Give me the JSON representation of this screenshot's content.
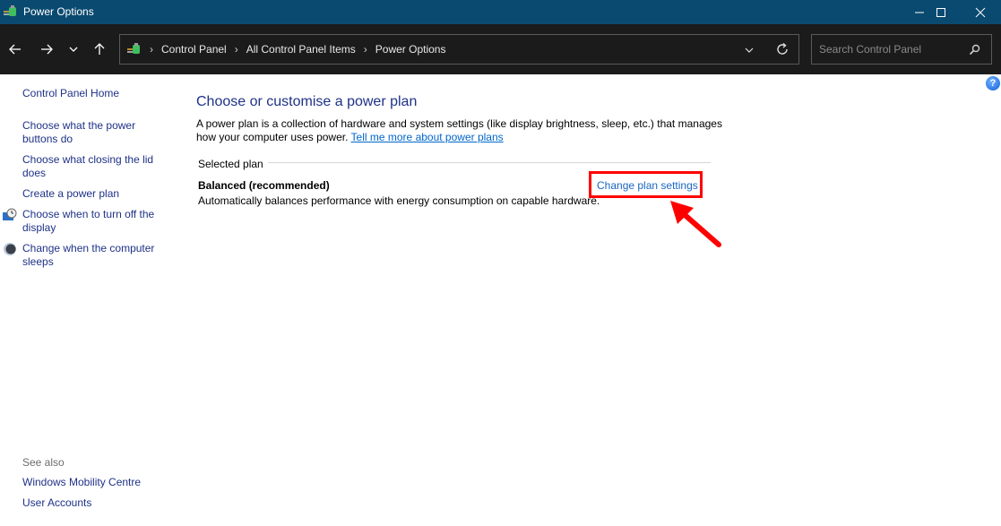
{
  "window": {
    "title": "Power Options",
    "icon": "power-options-icon",
    "controls": {
      "minimize": "minimize-icon",
      "maximize": "maximize-icon",
      "close": "close-icon"
    }
  },
  "navigation": {
    "back": "arrow-left-icon",
    "forward": "arrow-right-icon",
    "recent": "chevron-down-icon",
    "up": "arrow-up-icon",
    "breadcrumb": [
      "Control Panel",
      "All Control Panel Items",
      "Power Options"
    ],
    "search_placeholder": "Search Control Panel"
  },
  "sidebar": {
    "home": "Control Panel Home",
    "links": [
      {
        "label": "Choose what the power buttons do",
        "icon": null
      },
      {
        "label": "Choose what closing the lid does",
        "icon": null
      },
      {
        "label": "Create a power plan",
        "icon": null
      },
      {
        "label": "Choose when to turn off the display",
        "icon": "display-clock-icon"
      },
      {
        "label": "Change when the computer sleeps",
        "icon": "moon-icon"
      }
    ],
    "see_also_label": "See also",
    "see_also": [
      "Windows Mobility Centre",
      "User Accounts"
    ]
  },
  "main": {
    "heading": "Choose or customise a power plan",
    "description": "A power plan is a collection of hardware and system settings (like display brightness, sleep, etc.) that manages how your computer uses power.",
    "learn_more_link": "Tell me more about power plans",
    "group_label": "Selected plan",
    "plan": {
      "name": "Balanced (recommended)",
      "description": "Automatically balances performance with energy consumption on capable hardware.",
      "change_link": "Change plan settings"
    }
  },
  "annotation": {
    "highlight_color": "#ff0000",
    "target": "Change plan settings"
  },
  "help_label": "?"
}
